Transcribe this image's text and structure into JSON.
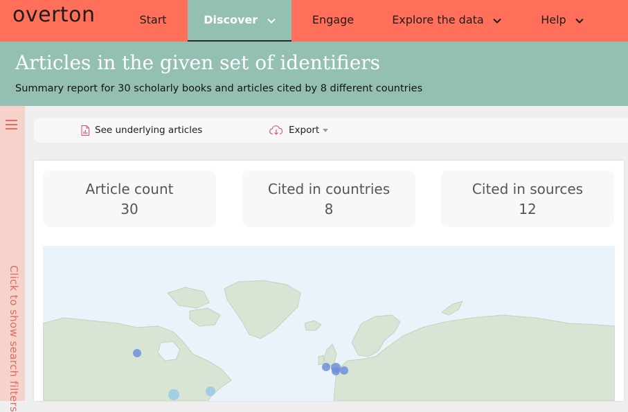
{
  "nav": {
    "logo": "overton",
    "items": [
      {
        "label": "Start"
      },
      {
        "label": "Discover",
        "active": true
      },
      {
        "label": "Engage"
      },
      {
        "label": "Explore the data"
      },
      {
        "label": "Help"
      }
    ]
  },
  "hero": {
    "title": "Articles in the given set of identifiers",
    "subtitle": "Summary report for 30 scholarly books and articles cited by 8 different countries"
  },
  "filters": {
    "toggle_label": "Click to show search filters",
    "menu_icon": "hamburger-menu-icon"
  },
  "toolbar": {
    "see_articles_label": "See underlying articles",
    "see_articles_icon": "document-chart-icon",
    "export_label": "Export",
    "export_icon": "cloud-download-icon"
  },
  "stats": [
    {
      "label": "Article count",
      "value": "30"
    },
    {
      "label": "Cited in countries",
      "value": "8"
    },
    {
      "label": "Cited in sources",
      "value": "12"
    }
  ],
  "colors": {
    "nav_bg": "#ff6f59",
    "accent_teal": "#93c0b3",
    "filter_strip": "#f5d3cb",
    "filter_text": "#e06b5e",
    "map_water": "#eaf3f9",
    "map_land": "#d8e4d4",
    "marker_blue": "#6f8fd9",
    "marker_light": "#9ccbe6"
  }
}
